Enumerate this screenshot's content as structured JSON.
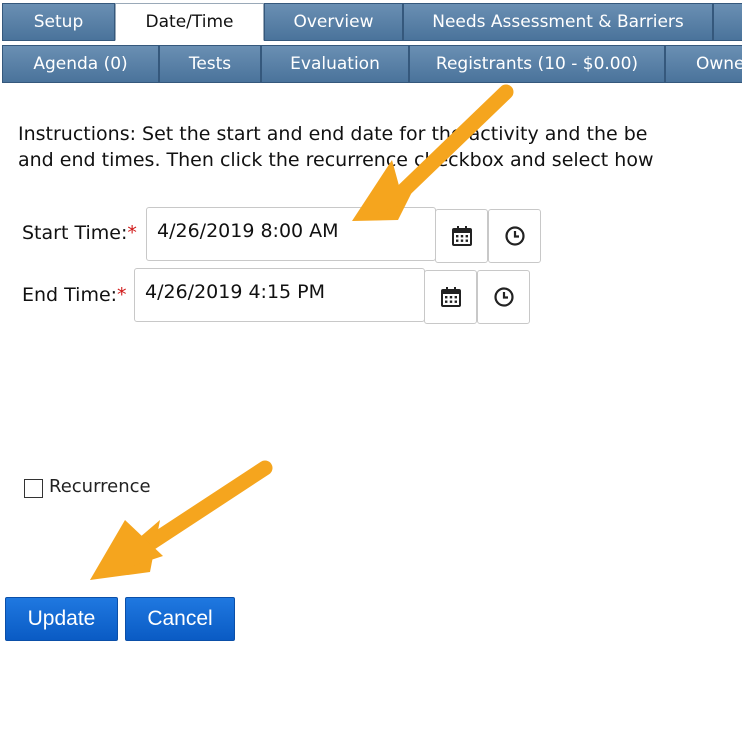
{
  "tabs_row1": [
    {
      "label": "Setup",
      "active": false
    },
    {
      "label": "Date/Time",
      "active": true
    },
    {
      "label": "Overview",
      "active": false
    },
    {
      "label": "Needs Assessment & Barriers",
      "active": false
    },
    {
      "label": "",
      "active": false
    }
  ],
  "tabs_row2": [
    {
      "label": "Agenda (0)"
    },
    {
      "label": "Tests"
    },
    {
      "label": "Evaluation"
    },
    {
      "label": "Registrants (10 - $0.00)"
    },
    {
      "label": "Owne"
    }
  ],
  "instructions": {
    "line1": "Instructions: Set the start and end date for the activity and the be",
    "line2": "and end times. Then click the recurrence checkbox and select how"
  },
  "start_time": {
    "label": "Start Time:",
    "required_mark": "*",
    "value": "4/26/2019 8:00 AM"
  },
  "end_time": {
    "label": "End Time:",
    "required_mark": "*",
    "value": "4/26/2019 4:15 PM"
  },
  "recurrence": {
    "label": "Recurrence",
    "checked": false
  },
  "actions": {
    "update": "Update",
    "cancel": "Cancel"
  },
  "colors": {
    "tab": "#5a81a8",
    "button": "#1168d6",
    "arrow": "#f5a51e",
    "required": "#d01818"
  }
}
